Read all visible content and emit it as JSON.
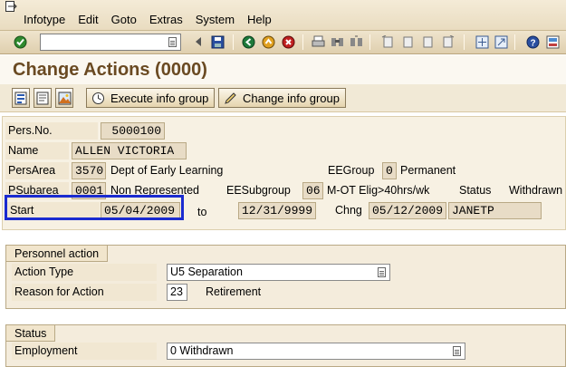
{
  "menu": {
    "items": [
      "Infotype",
      "Edit",
      "Goto",
      "Extras",
      "System",
      "Help"
    ]
  },
  "toolbar": {
    "command_value": "",
    "icons": [
      "enter-icon",
      "command-dropdown-icon",
      "back-arrow-icon",
      "save-icon",
      "back-icon",
      "exit-icon",
      "cancel-icon",
      "print-icon",
      "find-icon",
      "find-next-icon",
      "first-page-icon",
      "previous-page-icon",
      "next-page-icon",
      "last-page-icon",
      "create-session-icon",
      "shortcut-icon",
      "help-icon",
      "layout-icon"
    ]
  },
  "page": {
    "title": "Change Actions (0000)"
  },
  "app_toolbar": {
    "execute_label": "Execute info group",
    "change_label": "Change info group"
  },
  "header": {
    "pers_no_label": "Pers.No.",
    "pers_no_value": "5000100",
    "name_label": "Name",
    "name_value": "ALLEN VICTORIA",
    "persarea_label": "PersArea",
    "persarea_code": "3570",
    "persarea_text": "Dept of Early Learning",
    "eegroup_label": "EEGroup",
    "eegroup_code": "0",
    "eegroup_text": "Permanent",
    "psubarea_label": "PSubarea",
    "psubarea_code": "0001",
    "psubarea_text": "Non Represented",
    "eesubgroup_label": "EESubgroup",
    "eesubgroup_code": "06",
    "eesubgroup_text": "M-OT Elig>40hrs/wk",
    "status_label": "Status",
    "status_text": "Withdrawn",
    "start_label": "Start",
    "start_value": "05/04/2009",
    "to_label": "to",
    "to_value": "12/31/9999",
    "chng_label": "Chng",
    "chng_date": "05/12/2009",
    "chng_user": "JANETP"
  },
  "personnel_action": {
    "title": "Personnel action",
    "action_type_label": "Action Type",
    "action_type_value": "U5 Separation",
    "reason_label": "Reason for Action",
    "reason_code": "23",
    "reason_text": "Retirement"
  },
  "status_group": {
    "title": "Status",
    "employment_label": "Employment",
    "employment_value": "0 Withdrawn"
  }
}
